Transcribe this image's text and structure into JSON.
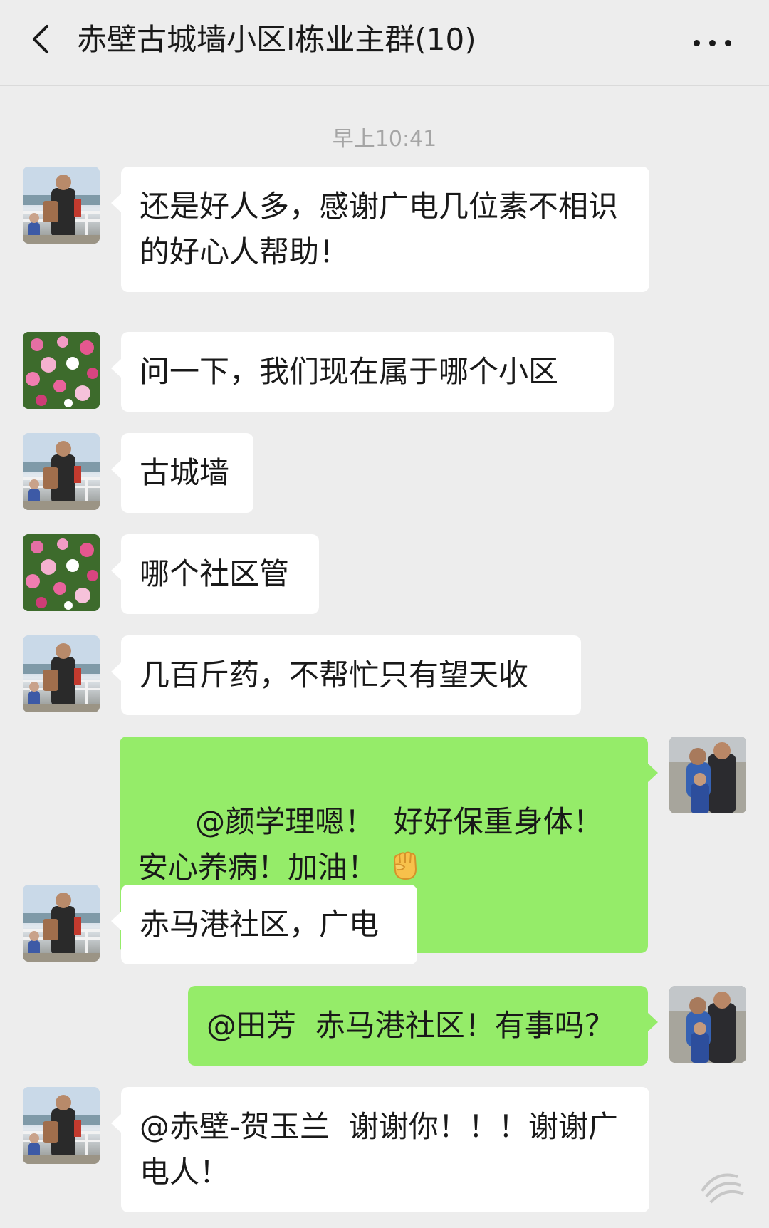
{
  "header": {
    "title": "赤壁古城墙小区Ⅰ栋业主群(10)"
  },
  "timestamp": "早上10:41",
  "messages": [
    {
      "sender": "incoming",
      "avatar": "man-railing-avatar",
      "text": "还是好人多，感谢广电几位素不相识的好心人帮助！"
    },
    {
      "sender": "incoming",
      "avatar": "flower-avatar",
      "text": "问一下，我们现在属于哪个小区"
    },
    {
      "sender": "incoming",
      "avatar": "man-railing-avatar",
      "text": "古城墙"
    },
    {
      "sender": "incoming",
      "avatar": "flower-avatar",
      "text": "哪个社区管"
    },
    {
      "sender": "incoming",
      "avatar": "man-railing-avatar",
      "text": "几百斤药，不帮忙只有望天收"
    },
    {
      "sender": "outgoing",
      "avatar": "couple-avatar",
      "text": "@颜学理嗯！  好好保重身体！安心养病！加油！",
      "emoji": "fist-emoji"
    },
    {
      "sender": "incoming",
      "avatar": "man-railing-avatar",
      "text": "赤马港社区，广电"
    },
    {
      "sender": "outgoing",
      "avatar": "couple-avatar",
      "text": "@田芳  赤马港社区！有事吗？"
    },
    {
      "sender": "incoming",
      "avatar": "man-railing-avatar",
      "text": "@赤壁-贺玉兰  谢谢你！！！谢谢广电人！"
    }
  ],
  "colors": {
    "background": "#ededed",
    "incoming_bubble": "#ffffff",
    "outgoing_bubble": "#95ec69",
    "timestamp": "#a5a5a5",
    "text": "#191919"
  }
}
